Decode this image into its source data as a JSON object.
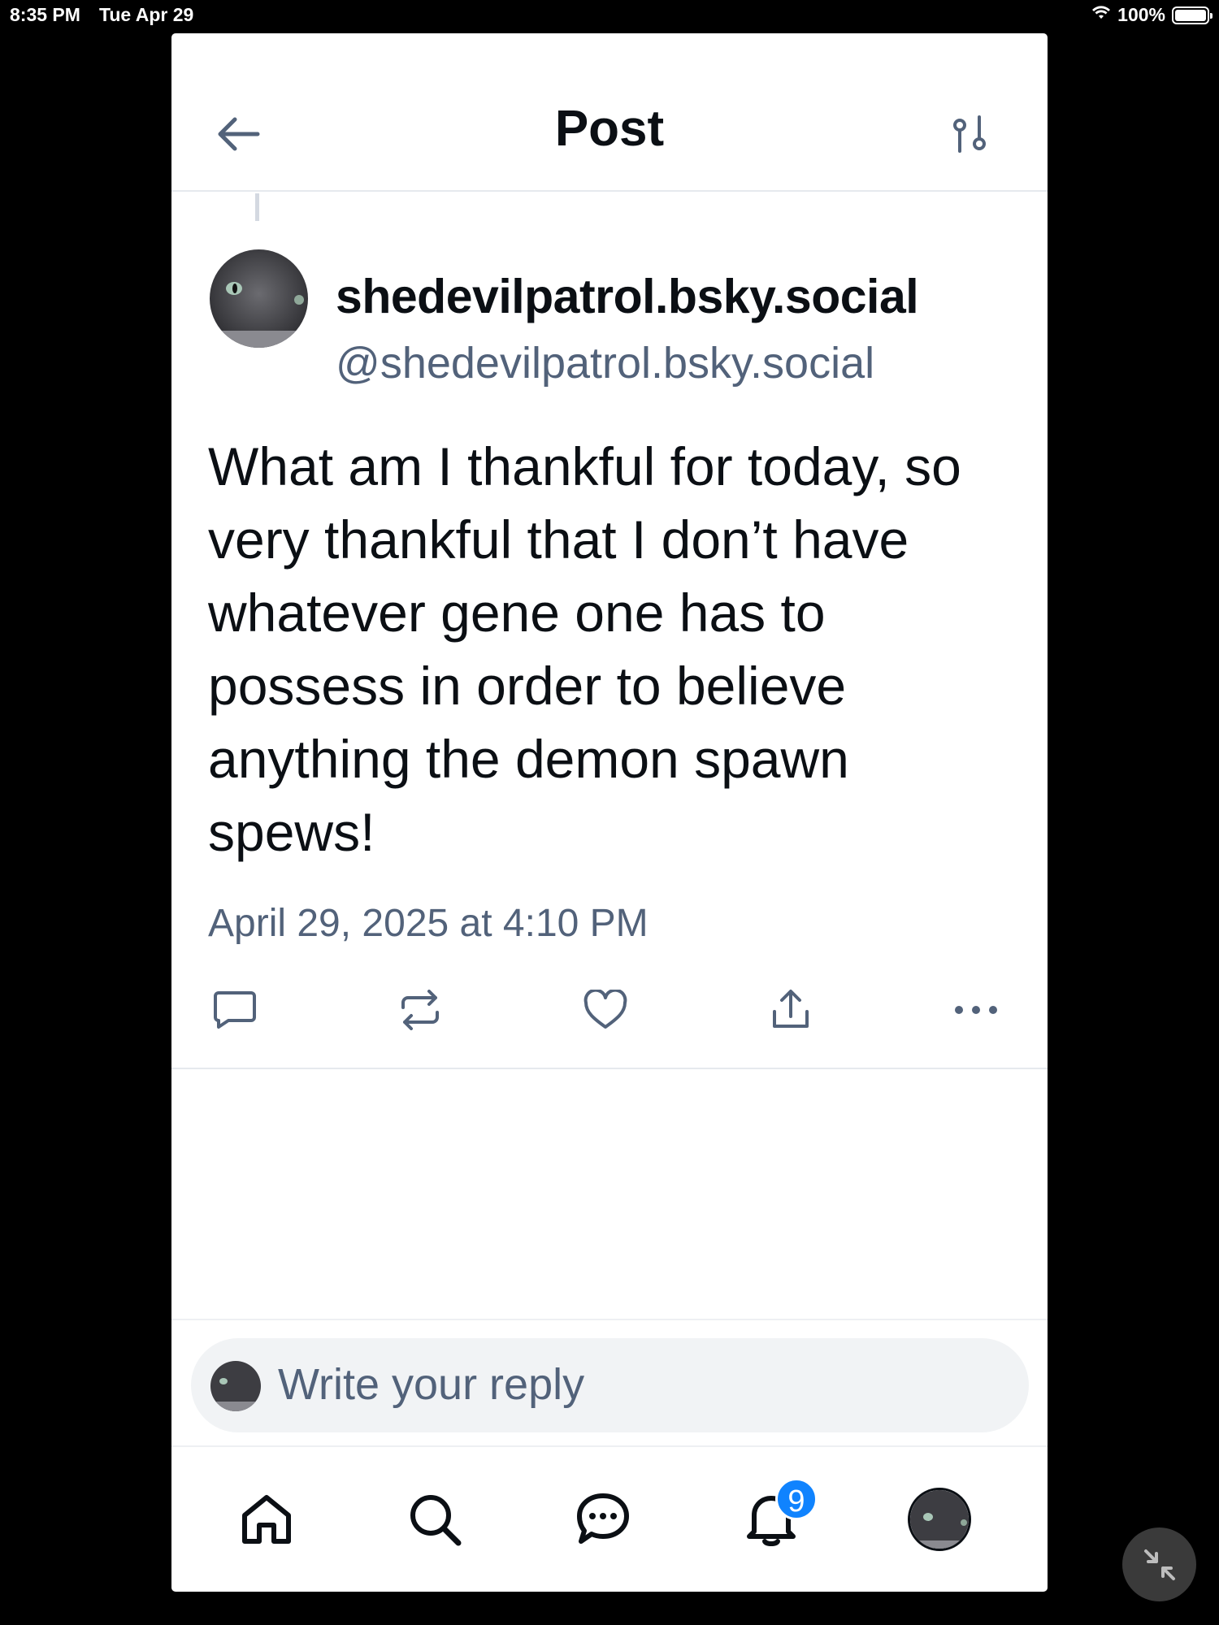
{
  "status_bar": {
    "time": "8:35 PM",
    "date": "Tue Apr 29",
    "battery": "100%",
    "icons": [
      "wifi-icon",
      "battery-icon"
    ]
  },
  "header": {
    "title": "Post",
    "back_icon": "arrow-left-icon",
    "filter_icon": "sliders-icon"
  },
  "post": {
    "author_name": "shedevilpatrol.bsky.social",
    "author_handle": "@shedevilpatrol.bsky.social",
    "text": "What am I thankful for today, so very thankful that I don’t have whatever gene one has to possess in order to believe anything the demon spawn spews!",
    "timestamp": "April 29, 2025 at 4:10 PM",
    "actions": [
      {
        "name": "reply",
        "icon": "comment-icon"
      },
      {
        "name": "repost",
        "icon": "repost-icon"
      },
      {
        "name": "like",
        "icon": "heart-icon"
      },
      {
        "name": "share",
        "icon": "share-icon"
      },
      {
        "name": "more",
        "icon": "ellipsis-icon"
      }
    ]
  },
  "reply": {
    "placeholder": "Write your reply"
  },
  "bottom_nav": {
    "items": [
      {
        "name": "home",
        "icon": "home-icon"
      },
      {
        "name": "search",
        "icon": "search-icon"
      },
      {
        "name": "chat",
        "icon": "chat-icon"
      },
      {
        "name": "notifications",
        "icon": "bell-icon",
        "badge": "9"
      },
      {
        "name": "profile",
        "icon": "avatar"
      }
    ]
  },
  "colors": {
    "text": "#0b0f14",
    "secondary": "#52627a",
    "badge": "#1083fe",
    "border": "#e6e9ee"
  }
}
